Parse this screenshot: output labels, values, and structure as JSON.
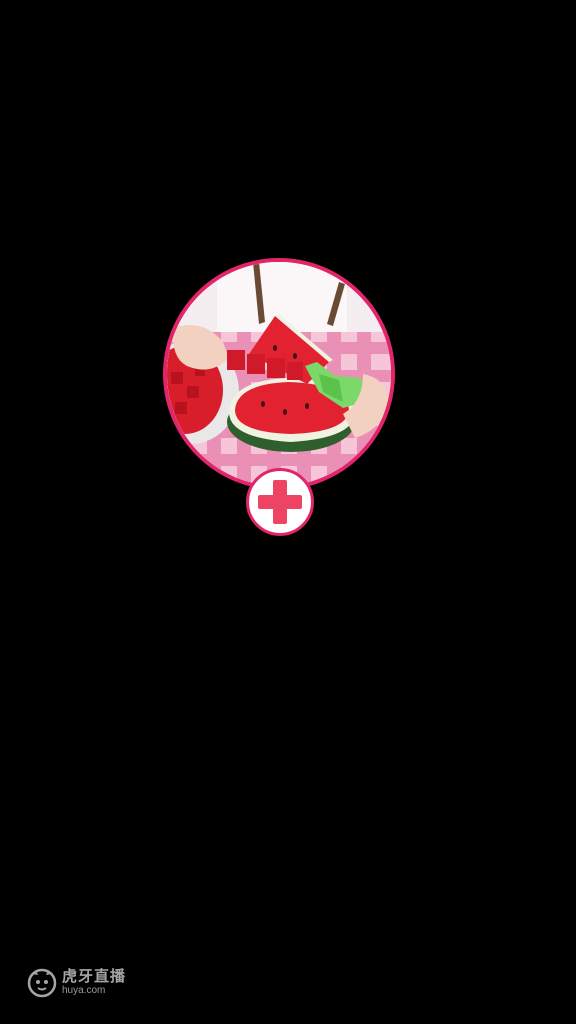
{
  "avatar": {
    "alt": "",
    "accent": "#e2246a"
  },
  "follow_button": {
    "icon": "plus-icon",
    "accent": "#ee4463"
  },
  "watermark": {
    "brand_cn": "虎牙直播",
    "brand_url": "huya.com",
    "icon": "huya-logo-icon"
  }
}
